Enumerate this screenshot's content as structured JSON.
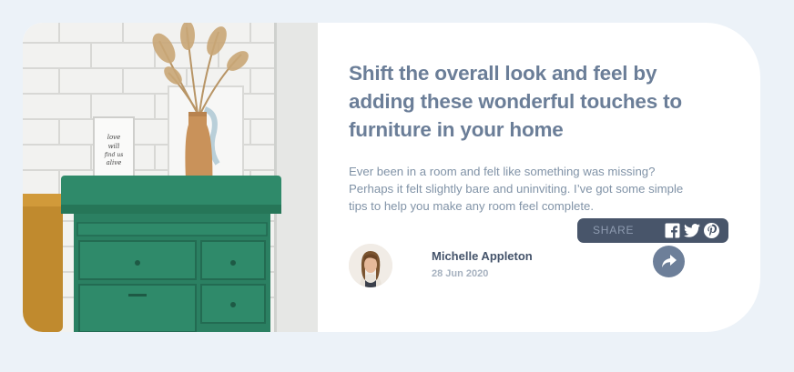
{
  "article": {
    "headline": "Shift the overall look and feel by adding these wonderful touches to furniture in your home",
    "description": "Ever been in a room and felt like something was missing? Perhaps it felt slightly bare and uninviting. I’ve got some simple tips to help you make any room feel complete.",
    "image_alt": "Green drawer chest with a vase of dried grass against a white brick wall",
    "frame_text": "love will find us alive"
  },
  "author": {
    "name": "Michelle Appleton",
    "date": "28 Jun 2020"
  },
  "share": {
    "label": "SHARE",
    "icons": [
      "facebook-icon",
      "twitter-icon",
      "pinterest-icon"
    ],
    "button_icon": "share-arrow-icon"
  },
  "colors": {
    "background": "#ecf2f8",
    "headline": "#6b7e98",
    "body_text": "#8193a7",
    "author_name": "#44536a",
    "share_panel": "#48556a",
    "share_button": "#6d7f99"
  }
}
